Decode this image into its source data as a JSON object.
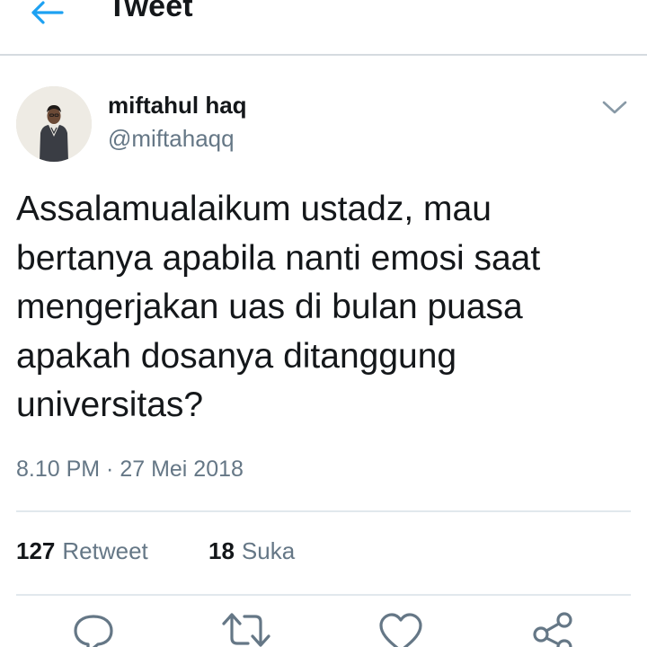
{
  "header": {
    "title": "Tweet",
    "back_icon": "arrow-left-icon",
    "accent_color": "#1da1f2"
  },
  "author": {
    "name": "miftahul haq",
    "handle": "@miftahaqq"
  },
  "tweet": {
    "lines": [
      "Assalamualaikum ustadz, mau",
      "bertanya apabila nanti emosi saat",
      "mengerjakan uas di bulan puasa",
      "apakah dosanya ditanggung",
      "universitas?"
    ],
    "timestamp": "8.10 PM · 27 Mei 2018"
  },
  "stats": {
    "retweets": {
      "count": "127",
      "label": "Retweet"
    },
    "likes": {
      "count": "18",
      "label": "Suka"
    }
  },
  "actions": [
    {
      "name": "reply",
      "icon": "reply-icon"
    },
    {
      "name": "retweet",
      "icon": "retweet-icon"
    },
    {
      "name": "like",
      "icon": "heart-icon"
    },
    {
      "name": "share",
      "icon": "share-icon"
    }
  ]
}
